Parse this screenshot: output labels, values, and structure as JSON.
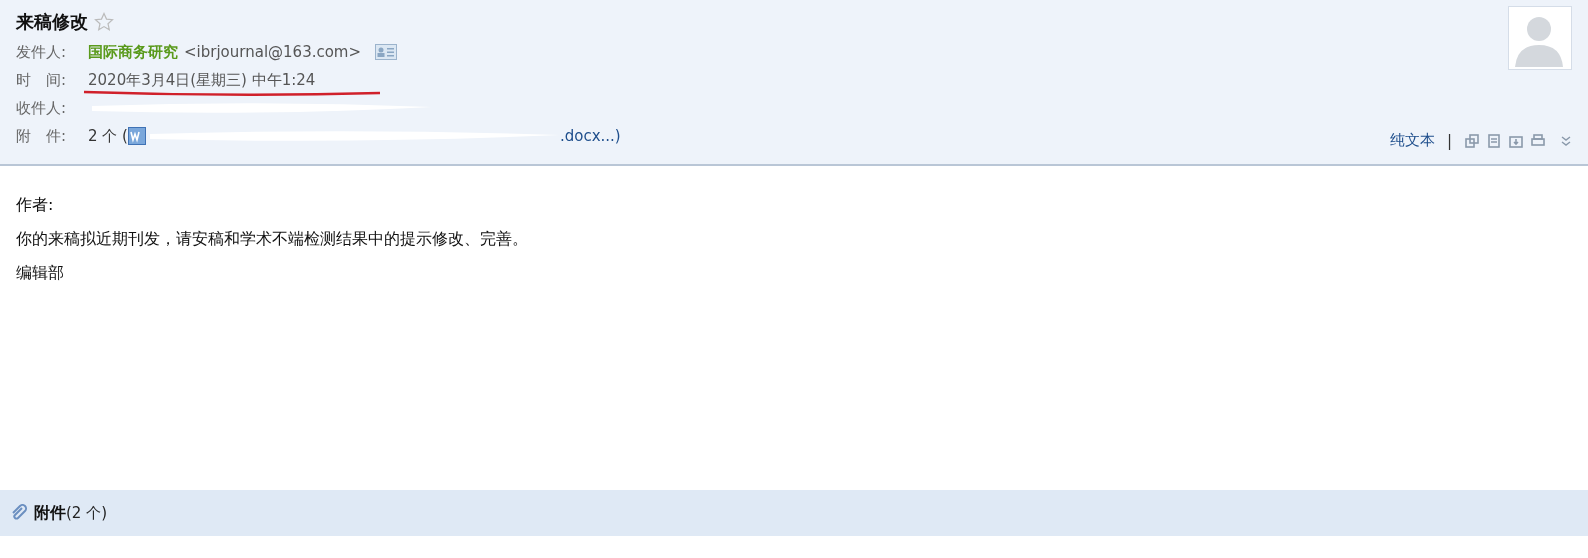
{
  "subject": {
    "title": "来稿修改",
    "starred": false
  },
  "header_rows": [
    {
      "kind": "sender",
      "label": "发件人:",
      "name": "国际商务研究",
      "address": "<ibrjournal@163.com>"
    },
    {
      "kind": "time",
      "label": "时　间:",
      "value": "2020年3月4日(星期三) 中午1:24"
    },
    {
      "kind": "recipient",
      "label": "收件人:"
    },
    {
      "kind": "attachment",
      "label": "附　件:",
      "count": "2 个 (",
      "tail": ".docx...)"
    }
  ],
  "toolbar": {
    "plain_text": "纯文本",
    "separator": "|"
  },
  "body": [
    "作者:",
    "你的来稿拟近期刊发，请安稿和学术不端检测结果中的提示修改、完善。",
    "编辑部"
  ],
  "attachments_bar": {
    "title": "附件",
    "count": "(2 个)"
  }
}
